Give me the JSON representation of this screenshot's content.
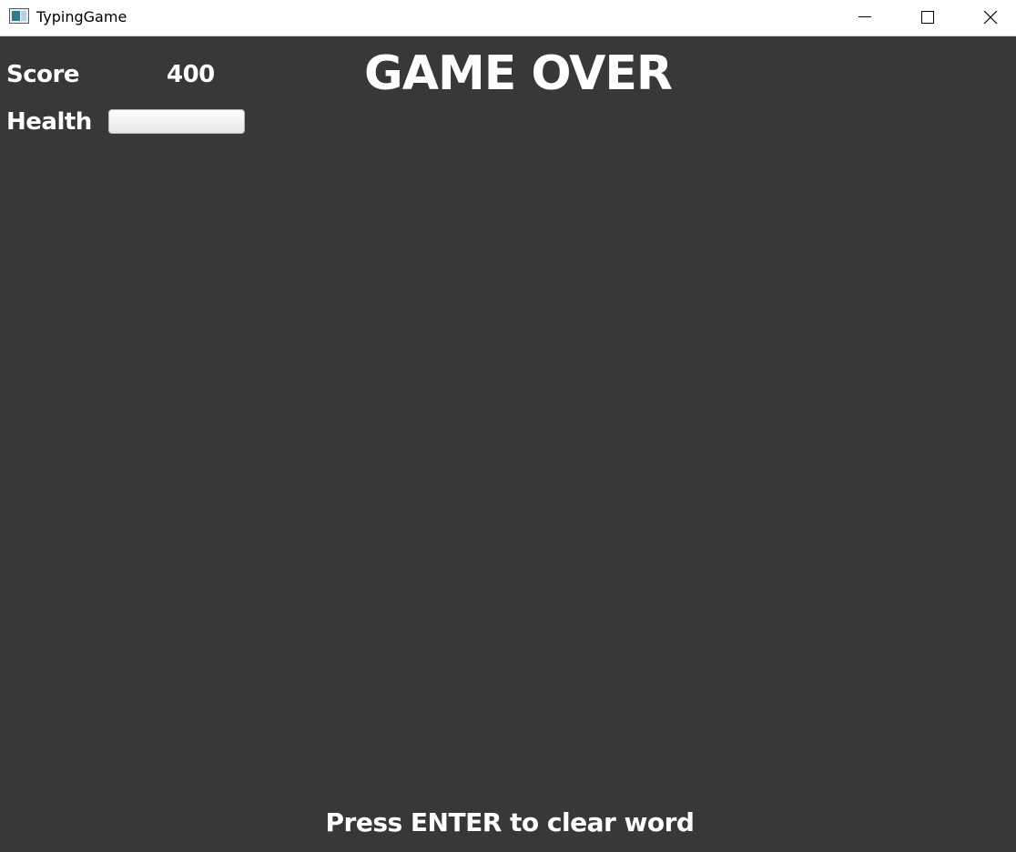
{
  "window": {
    "title": "TypingGame",
    "app_icon": "app-window-icon",
    "controls": {
      "minimize_icon": "minimize-icon",
      "maximize_icon": "maximize-icon",
      "close_icon": "close-icon"
    }
  },
  "hud": {
    "score_label": "Score",
    "score_value": "400",
    "health_label": "Health",
    "health_level": 0
  },
  "game": {
    "status": "GAME OVER",
    "prompt": "Press ENTER to clear word"
  },
  "colors": {
    "background": "#383838",
    "text": "#ffffff",
    "titlebar": "#ffffff"
  }
}
